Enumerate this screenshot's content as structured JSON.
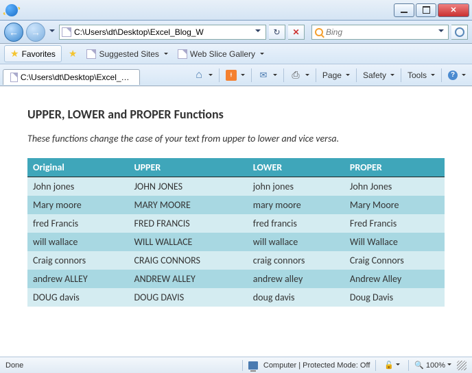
{
  "window": {
    "address": "C:\\Users\\dt\\Desktop\\Excel_Blog_W",
    "search_placeholder": "Bing",
    "tab_title": "C:\\Users\\dt\\Desktop\\Excel_Blog_Workb..."
  },
  "favbar": {
    "favorites": "Favorites",
    "suggested": "Suggested Sites",
    "webslice": "Web Slice Gallery"
  },
  "cmd": {
    "page": "Page",
    "safety": "Safety",
    "tools": "Tools"
  },
  "doc": {
    "title": "UPPER, LOWER and PROPER Functions",
    "desc": "These functions change the case of your text from upper to lower and vice versa.",
    "headers": {
      "c0": "Original",
      "c1": "UPPER",
      "c2": "LOWER",
      "c3": "PROPER"
    },
    "rows": [
      {
        "c0": "John jones",
        "c1": "JOHN JONES",
        "c2": "john jones",
        "c3": "John Jones"
      },
      {
        "c0": "Mary moore",
        "c1": "MARY MOORE",
        "c2": "mary moore",
        "c3": "Mary Moore"
      },
      {
        "c0": "fred Francis",
        "c1": "FRED FRANCIS",
        "c2": "fred francis",
        "c3": "Fred Francis"
      },
      {
        "c0": "will wallace",
        "c1": "WILL WALLACE",
        "c2": "will wallace",
        "c3": "Will Wallace"
      },
      {
        "c0": "Craig connors",
        "c1": "CRAIG CONNORS",
        "c2": "craig connors",
        "c3": "Craig Connors"
      },
      {
        "c0": "andrew ALLEY",
        "c1": "ANDREW ALLEY",
        "c2": "andrew alley",
        "c3": "Andrew Alley"
      },
      {
        "c0": "DOUG davis",
        "c1": "DOUG DAVIS",
        "c2": "doug davis",
        "c3": "Doug Davis"
      }
    ]
  },
  "status": {
    "done": "Done",
    "mode": "Computer | Protected Mode: Off",
    "zoom": "100%"
  }
}
